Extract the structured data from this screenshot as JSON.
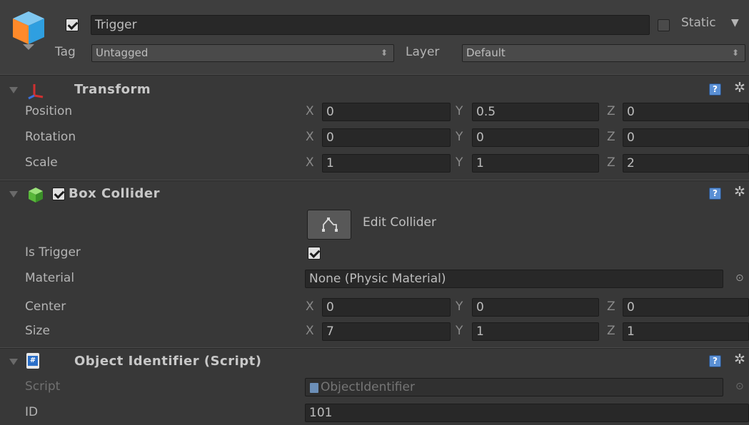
{
  "object": {
    "name": "Trigger",
    "static_label": "Static",
    "tag_label": "Tag",
    "tag_value": "Untagged",
    "layer_label": "Layer",
    "layer_value": "Default"
  },
  "transform": {
    "title": "Transform",
    "rows": [
      {
        "label": "Position",
        "x": "0",
        "y": "0.5",
        "z": "0"
      },
      {
        "label": "Rotation",
        "x": "0",
        "y": "0",
        "z": "0"
      },
      {
        "label": "Scale",
        "x": "1",
        "y": "1",
        "z": "2"
      }
    ]
  },
  "box_collider": {
    "title": "Box Collider",
    "edit_collider_label": "Edit Collider",
    "is_trigger_label": "Is Trigger",
    "material_label": "Material",
    "material_value": "None (Physic Material)",
    "center": {
      "label": "Center",
      "x": "0",
      "y": "0",
      "z": "0"
    },
    "size": {
      "label": "Size",
      "x": "7",
      "y": "1",
      "z": "1"
    }
  },
  "script_component": {
    "title": "Object Identifier (Script)",
    "script_label": "Script",
    "script_value": "ObjectIdentifier",
    "id_label": "ID",
    "id_value": "101"
  },
  "axes": {
    "x": "X",
    "y": "Y",
    "z": "Z"
  },
  "colors": {
    "background": "#383838",
    "field": "#282828",
    "help_icon": "#5a8fd4"
  },
  "icons": {
    "game_object": "cube-icon",
    "transform": "transform-axes-icon",
    "box_collider": "green-cube-icon",
    "script": "csharp-script-icon",
    "help": "help-icon",
    "settings": "gear-icon"
  }
}
